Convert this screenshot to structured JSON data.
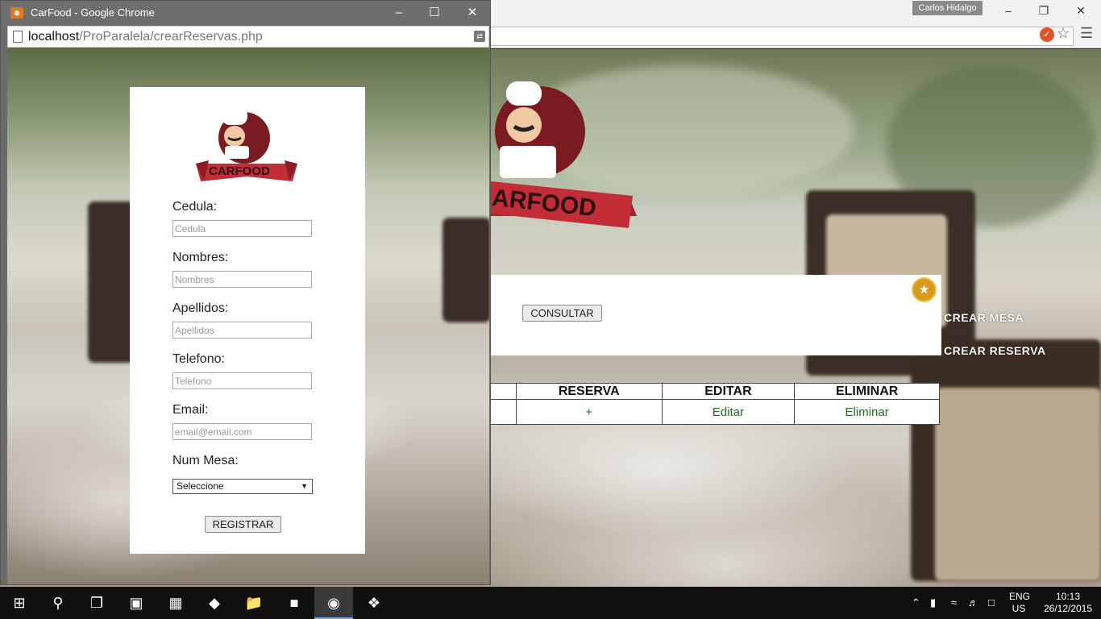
{
  "background_window": {
    "user_name": "Carlos Hidalgo",
    "consult_button": "CONSULTAR",
    "side_links": [
      "CREAR MESA",
      "CREAR RESERVA"
    ],
    "table": {
      "headers": [
        "RESERVA",
        "EDITAR",
        "ELIMINAR"
      ],
      "row": [
        "+",
        "Editar",
        "Eliminar"
      ]
    },
    "logo_text": "CARFOOD"
  },
  "popup": {
    "window_title": "CarFood - Google Chrome",
    "url_host": "localhost",
    "url_path": "/ProParalela/crearReservas.php",
    "logo_text": "CARFOOD",
    "form": {
      "cedula_label": "Cedula:",
      "cedula_placeholder": "Cedula",
      "nombres_label": "Nombres:",
      "nombres_placeholder": "Nombres",
      "apellidos_label": "Apellidos:",
      "apellidos_placeholder": "Apellidos",
      "telefono_label": "Telefono:",
      "telefono_placeholder": "Telefono",
      "email_label": "Email:",
      "email_placeholder": "email@email.com",
      "mesa_label": "Num Mesa:",
      "mesa_selected": "Seleccione",
      "submit_label": "REGISTRAR"
    }
  },
  "taskbar": {
    "language": "ENG",
    "region": "US",
    "time": "10:13",
    "date": "26/12/2015"
  },
  "colors": {
    "link_green": "#1e6e1e",
    "titlebar_gray": "#6e6e6e",
    "badge_gold": "#d79a1e"
  }
}
